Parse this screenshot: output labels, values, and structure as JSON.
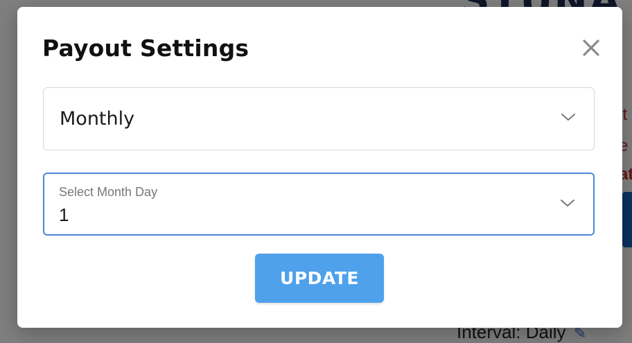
{
  "background": {
    "logo_fragment": "STUNA",
    "red_fragments": [
      "it",
      "e",
      "at"
    ],
    "interval_text": "Interval: Daily",
    "edit_icon": "pencil-icon"
  },
  "modal": {
    "title": "Payout Settings",
    "close_icon": "close-icon",
    "interval_select": {
      "value": "Monthly",
      "icon": "chevron-down-icon"
    },
    "month_day_select": {
      "label": "Select Month Day",
      "value": "1",
      "icon": "chevron-down-icon"
    },
    "update_label": "UPDATE"
  },
  "colors": {
    "accent": "#4fa1ec",
    "focus_border": "#4a86d6",
    "overlay": "rgba(0,0,0,0.5)"
  }
}
